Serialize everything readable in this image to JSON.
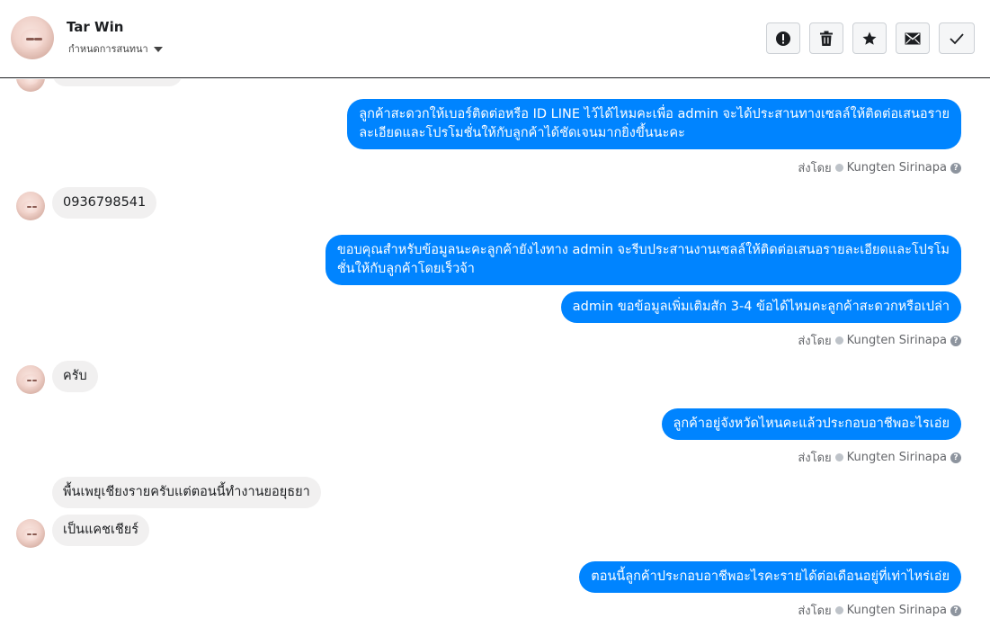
{
  "header": {
    "name": "Tar Win",
    "subtitle": "กำหนดการสนทนา",
    "tools": [
      {
        "name": "spam-icon"
      },
      {
        "name": "trash-icon"
      },
      {
        "name": "star-icon"
      },
      {
        "name": "envelope-icon"
      },
      {
        "name": "check-icon"
      }
    ]
  },
  "thread": {
    "messages": [
      {
        "dir": "out",
        "lines": [
          "ลูกค้าสะดวกให้เบอร์ติดต่อหรือ  ID LINE ไว้ได้ไหมคะเพื่อ admin จะได้ประสานทางเซลล์ให้ติดต่อเสนอราย",
          "ละเอียดและโปรโมชั่นให้กับลูกค้าได้ชัดเจนมากยิ่งขึ้นนะคะ"
        ]
      },
      {
        "dir": "in",
        "text": "0936798541"
      },
      {
        "dir": "out",
        "lines": [
          "ขอบคุณสำหรับข้อมูลนะคะลูกค้ายังไงทาง admin จะรีบประสานงานเซลล์ให้ติดต่อเสนอรายละเอียดและโปรโม",
          "ชั่นให้กับลูกค้าโดยเร็วจ้า"
        ]
      },
      {
        "dir": "out",
        "text": "admin ขอข้อมูลเพิ่มเติมสัก 3-4 ข้อได้ไหมคะลูกค้าสะดวกหรือเปล่า"
      },
      {
        "dir": "in",
        "text": "ครับ"
      },
      {
        "dir": "out",
        "text": "ลูกค้าอยู่จังหวัดไหนคะแล้วประกอบอาชีพอะไรเอ่ย"
      },
      {
        "dir": "in",
        "text": "พื้นเพยุเชียงรายครับแต่ตอนนี้ทำงานยอยุธยา"
      },
      {
        "dir": "in",
        "text": "เป็นแคชเชียร์"
      },
      {
        "dir": "out",
        "text": "ตอนนี้ลูกค้าประกอบอาชีพอะไรคะรายได้ต่อเดือนอยู่ที่เท่าไหร่เอ่ย"
      }
    ],
    "sent_by_label": "ส่งโดย",
    "sender": "Kungten Sirinapa",
    "help": "?"
  }
}
